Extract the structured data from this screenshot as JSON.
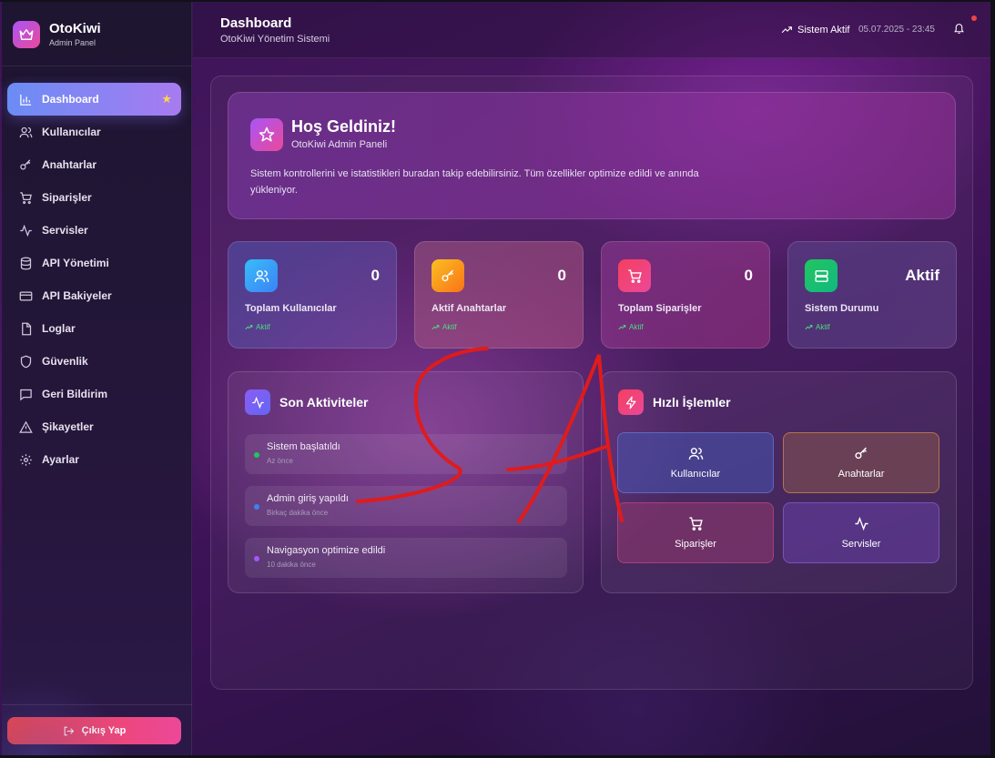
{
  "brand": {
    "title": "OtoKiwi",
    "subtitle": "Admin Panel",
    "icon": "crown-icon"
  },
  "sidebar": {
    "items": [
      {
        "label": "Dashboard",
        "icon": "bar-chart-icon",
        "active": true
      },
      {
        "label": "Kullanıcılar",
        "icon": "users-icon"
      },
      {
        "label": "Anahtarlar",
        "icon": "key-icon"
      },
      {
        "label": "Siparişler",
        "icon": "cart-icon"
      },
      {
        "label": "Servisler",
        "icon": "activity-icon"
      },
      {
        "label": "API Yönetimi",
        "icon": "database-icon"
      },
      {
        "label": "API Bakiyeler",
        "icon": "credit-card-icon"
      },
      {
        "label": "Loglar",
        "icon": "file-icon"
      },
      {
        "label": "Güvenlik",
        "icon": "shield-icon"
      },
      {
        "label": "Geri Bildirim",
        "icon": "message-icon"
      },
      {
        "label": "Şikayetler",
        "icon": "alert-triangle-icon"
      },
      {
        "label": "Ayarlar",
        "icon": "gear-icon"
      }
    ],
    "logout_label": "Çıkış Yap"
  },
  "header": {
    "title": "Dashboard",
    "subtitle": "OtoKiwi Yönetim Sistemi",
    "status": "Sistem Aktif",
    "datetime": "05.07.2025 - 23:45"
  },
  "welcome": {
    "title": "Hoş Geldiniz!",
    "subtitle": "OtoKiwi Admin Paneli",
    "text": "Sistem kontrollerini ve istatistikleri buradan takip edebilirsiniz. Tüm özellikler optimize edildi ve anında yükleniyor."
  },
  "stats": [
    {
      "value": "0",
      "label": "Toplam Kullanıcılar",
      "trend": "Aktif",
      "color": "#3b82f6",
      "icon": "users-icon"
    },
    {
      "value": "0",
      "label": "Aktif Anahtarlar",
      "trend": "Aktif",
      "color": "#f59e0b",
      "icon": "key-icon"
    },
    {
      "value": "0",
      "label": "Toplam Siparişler",
      "trend": "Aktif",
      "color": "#f43f5e",
      "icon": "cart-icon"
    },
    {
      "value": "Aktif",
      "label": "Sistem Durumu",
      "trend": "Aktif",
      "color": "#22c55e",
      "icon": "server-icon"
    }
  ],
  "activities": {
    "title": "Son Aktiviteler",
    "items": [
      {
        "title": "Sistem başlatıldı",
        "time": "Az önce",
        "color": "#22c55e"
      },
      {
        "title": "Admin giriş yapıldı",
        "time": "Birkaç dakika önce",
        "color": "#3b82f6"
      },
      {
        "title": "Navigasyon optimize edildi",
        "time": "10 dakika önce",
        "color": "#a855f7"
      }
    ]
  },
  "quick_actions": {
    "title": "Hızlı İşlemler",
    "items": [
      {
        "label": "Kullanıcılar",
        "icon": "users-icon"
      },
      {
        "label": "Anahtarlar",
        "icon": "key-icon"
      },
      {
        "label": "Siparişler",
        "icon": "cart-icon"
      },
      {
        "label": "Servisler",
        "icon": "activity-icon"
      }
    ]
  }
}
